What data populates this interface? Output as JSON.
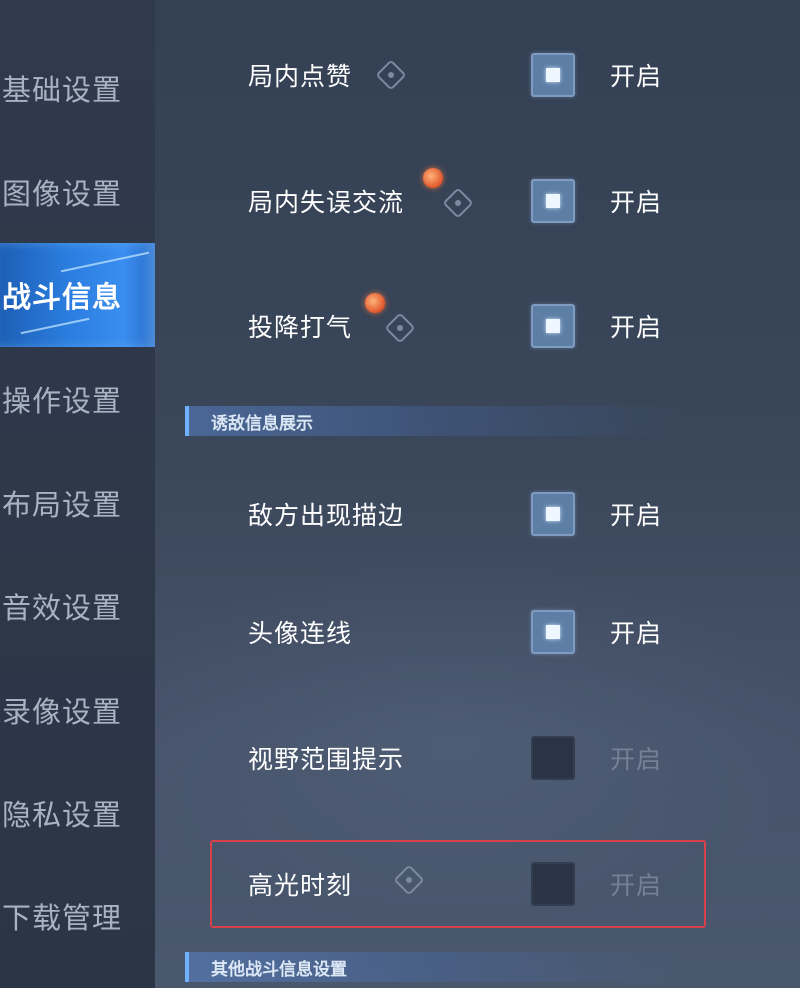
{
  "sidebar": {
    "items": [
      {
        "label": "基础设置",
        "active": false
      },
      {
        "label": "图像设置",
        "active": false
      },
      {
        "label": "战斗信息",
        "active": true
      },
      {
        "label": "操作设置",
        "active": false
      },
      {
        "label": "布局设置",
        "active": false
      },
      {
        "label": "音效设置",
        "active": false
      },
      {
        "label": "录像设置",
        "active": false
      },
      {
        "label": "隐私设置",
        "active": false
      },
      {
        "label": "下载管理",
        "active": false
      }
    ]
  },
  "sections": {
    "enemy_info": "诱敌信息展示",
    "other_battle": "其他战斗信息设置"
  },
  "settings": [
    {
      "label": "局内点赞",
      "enabled": true,
      "state_label": "开启",
      "has_info_icon": true,
      "is_new": false
    },
    {
      "label": "局内失误交流",
      "enabled": true,
      "state_label": "开启",
      "has_info_icon": true,
      "is_new": true
    },
    {
      "label": "投降打气",
      "enabled": true,
      "state_label": "开启",
      "has_info_icon": true,
      "is_new": true
    },
    {
      "label": "敌方出现描边",
      "enabled": true,
      "state_label": "开启",
      "has_info_icon": false,
      "is_new": false
    },
    {
      "label": "头像连线",
      "enabled": true,
      "state_label": "开启",
      "has_info_icon": false,
      "is_new": false
    },
    {
      "label": "视野范围提示",
      "enabled": false,
      "state_label": "开启",
      "has_info_icon": false,
      "is_new": false
    },
    {
      "label": "高光时刻",
      "enabled": false,
      "state_label": "开启",
      "has_info_icon": true,
      "is_new": false
    }
  ],
  "colors": {
    "accent": "#2b7ee0",
    "highlight_border": "#d8404a",
    "new_badge": "#e0562a"
  }
}
